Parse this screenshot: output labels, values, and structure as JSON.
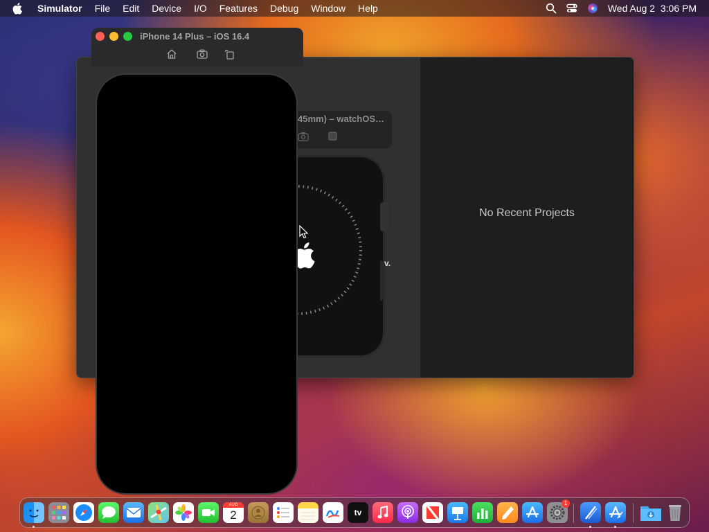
{
  "menubar": {
    "app_name": "Simulator",
    "menus": [
      "File",
      "Edit",
      "Device",
      "I/O",
      "Features",
      "Debug",
      "Window",
      "Help"
    ],
    "datetime": "Wed Aug 2  3:06 PM"
  },
  "iphone_window": {
    "title": "iPhone 14 Plus – iOS 16.4",
    "toolbar": [
      "home-icon",
      "screenshot-icon",
      "rotate-icon"
    ]
  },
  "watch_window": {
    "title_visible": "45mm) – watchOS…",
    "side_label": "v."
  },
  "xcode_welcome": {
    "recent_projects_empty": "No Recent Projects"
  },
  "dock": {
    "calendar_month": "AUG",
    "calendar_day": "2",
    "tv_label": "tv",
    "settings_badge": "1"
  }
}
